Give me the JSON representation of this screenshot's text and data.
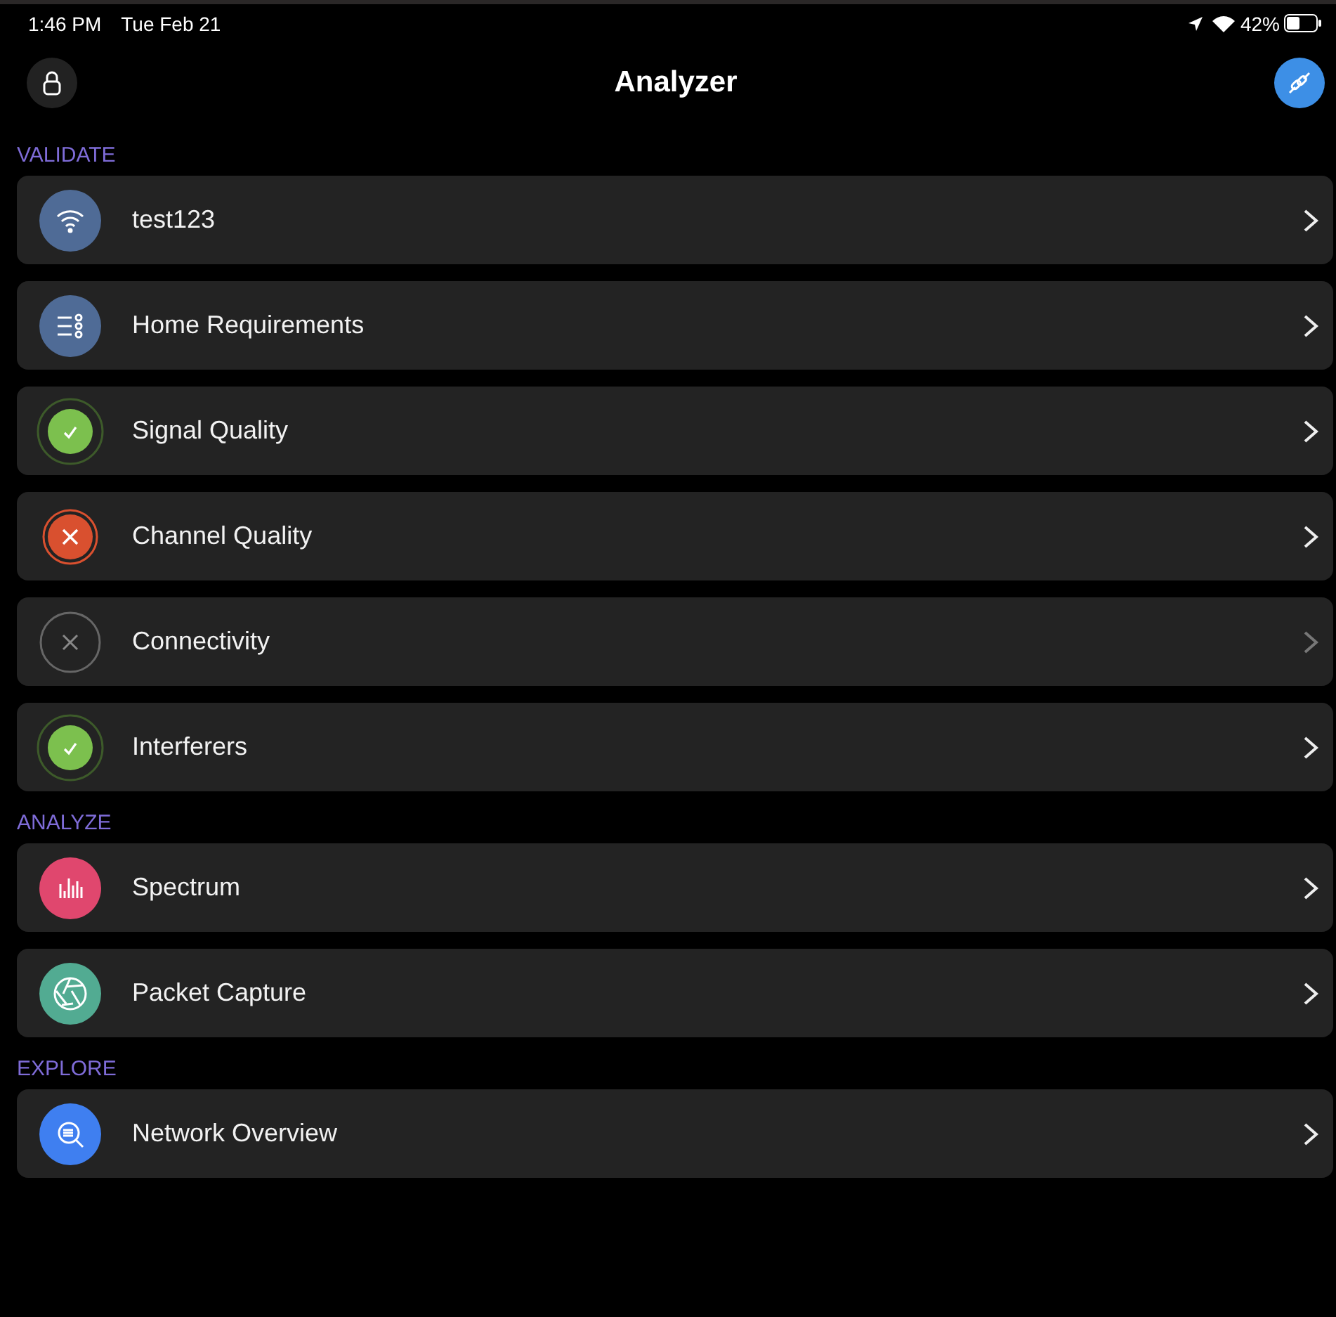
{
  "status_bar": {
    "time": "1:46 PM",
    "date": "Tue Feb 21",
    "battery": "42%"
  },
  "nav": {
    "title": "Analyzer"
  },
  "sections": [
    {
      "title": "VALIDATE",
      "items": [
        {
          "label": "test123",
          "kind": "wifi",
          "disabled": false
        },
        {
          "label": "Home Requirements",
          "kind": "requirements",
          "disabled": false
        },
        {
          "label": "Signal Quality",
          "kind": "pass",
          "disabled": false
        },
        {
          "label": "Channel Quality",
          "kind": "fail",
          "disabled": false
        },
        {
          "label": "Connectivity",
          "kind": "pending",
          "disabled": true
        },
        {
          "label": "Interferers",
          "kind": "pass",
          "disabled": false
        }
      ]
    },
    {
      "title": "ANALYZE",
      "items": [
        {
          "label": "Spectrum",
          "kind": "spectrum",
          "disabled": false
        },
        {
          "label": "Packet Capture",
          "kind": "capture",
          "disabled": false
        }
      ]
    },
    {
      "title": "EXPLORE",
      "items": [
        {
          "label": "Network Overview",
          "kind": "overview",
          "disabled": false
        }
      ]
    }
  ]
}
